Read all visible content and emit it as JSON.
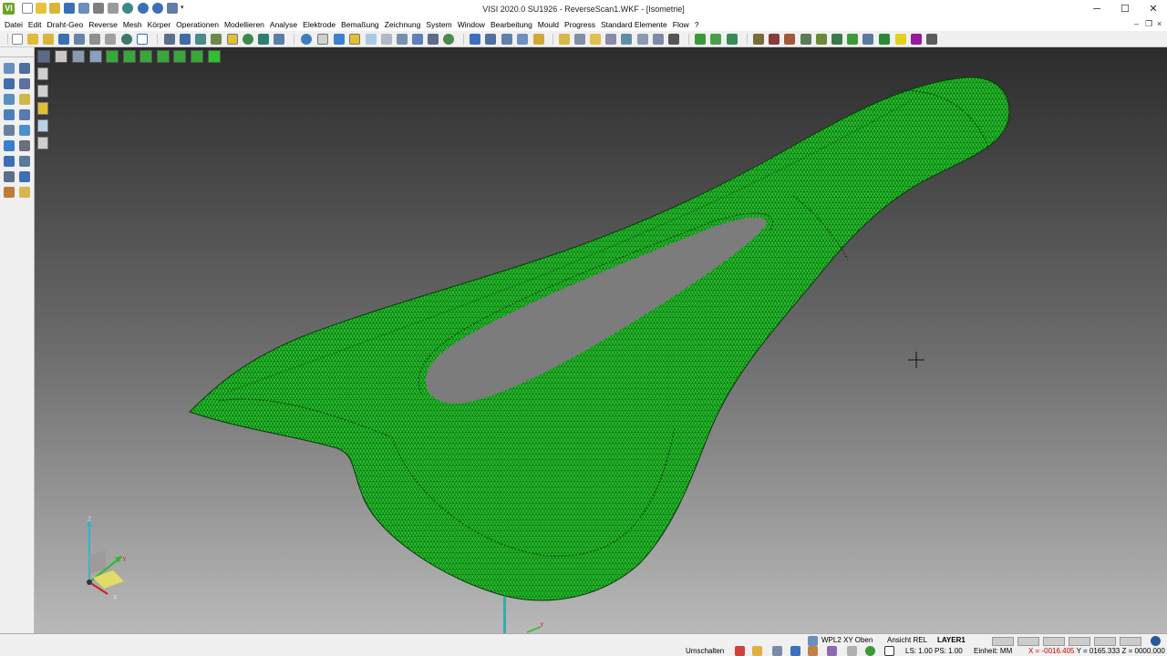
{
  "window": {
    "title": "VISI 2020.0 SU1926 - ReverseScan1.WKF - [Isometrie]",
    "app_icon": "VI",
    "controls": {
      "minimize": "─",
      "maximize": "☐",
      "close": "✕"
    },
    "mdi_controls": {
      "minimize": "–",
      "restore": "❐",
      "close": "×"
    }
  },
  "menu": [
    "Datei",
    "Edit",
    "Draht-Geo",
    "Reverse",
    "Mesh",
    "Körper",
    "Operationen",
    "Modellieren",
    "Analyse",
    "Elektrode",
    "Bemaßung",
    "Zeichnung",
    "System",
    "Window",
    "Bearbeitung",
    "Mould",
    "Progress",
    "Standard Elemente",
    "Flow",
    "?"
  ],
  "viewport": {
    "view": "Isometrie",
    "background_top": "#2c2c2c",
    "background_bottom": "#b9b9b9",
    "mesh_color": "#22c42a",
    "mesh_line_color": "#0a3a0a",
    "axis": {
      "z": "Z",
      "y": "Y",
      "x": "X"
    },
    "cursor_icon": "crosshair-icon"
  },
  "status": {
    "mode": "Umschalten",
    "workplane": "WPL2 XY Oben",
    "view": "Ansicht REL",
    "layer": "LAYER1",
    "scale": "LS: 1.00 PS: 1.00",
    "unit": "Einheit: MM",
    "coord_x": "X = -0016.405",
    "coord_y": "Y = 0165.333",
    "coord_z": "Z = 0000.000",
    "coord_x_color": "#d00000"
  }
}
